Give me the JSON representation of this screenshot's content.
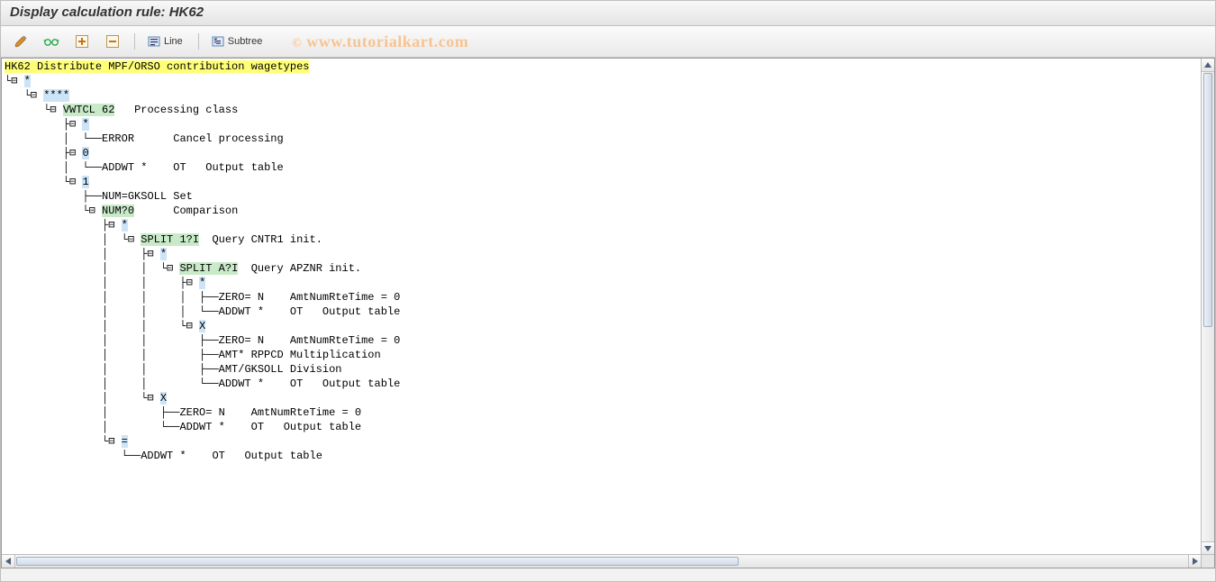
{
  "title": "Display calculation rule: HK62",
  "toolbar": {
    "line_label": "Line",
    "subtree_label": "Subtree"
  },
  "watermark": "www.tutorialkart.com",
  "tree": {
    "rule_code": "HK62",
    "rule_desc": "Distribute MPF/ORSO contribution wagetypes",
    "n_star1": "*",
    "n_star4": "****",
    "vwtcl_code": "VWTCL 62",
    "vwtcl_desc": "Processing class",
    "br_star": "*",
    "error_code": "ERROR",
    "error_desc": "Cancel processing",
    "br_0": "0",
    "addwt0_code": "ADDWT *",
    "addwt0_op": "OT",
    "addwt0_desc": "Output table",
    "br_1": "1",
    "num_set_code": "NUM=GKSOLL",
    "num_set_desc": "Set",
    "num_cmp_code": "NUM?0",
    "num_cmp_desc": "Comparison",
    "cmp_star": "*",
    "split1_code": "SPLIT 1?I",
    "split1_desc": "Query CNTR1 init.",
    "s1_star": "*",
    "splitA_code": "SPLIT A?I",
    "splitA_desc": "Query APZNR init.",
    "sA_star": "*",
    "zero1_code": "ZERO= N",
    "zero_desc": "AmtNumRteTime = 0",
    "addwt_code": "ADDWT *",
    "addwt_op": "OT",
    "addwt_desc": "Output table",
    "sA_X": "X",
    "amt_mul_code": "AMT* RPPCD",
    "amt_mul_desc": "Multiplication",
    "amt_div_code": "AMT/GKSOLL",
    "amt_div_desc": "Division",
    "s1_X": "X",
    "cmp_eq": "=",
    "addwt_eq_code": "ADDWT *",
    "addwt_eq_op": "OT",
    "addwt_eq_desc": "Output table"
  }
}
